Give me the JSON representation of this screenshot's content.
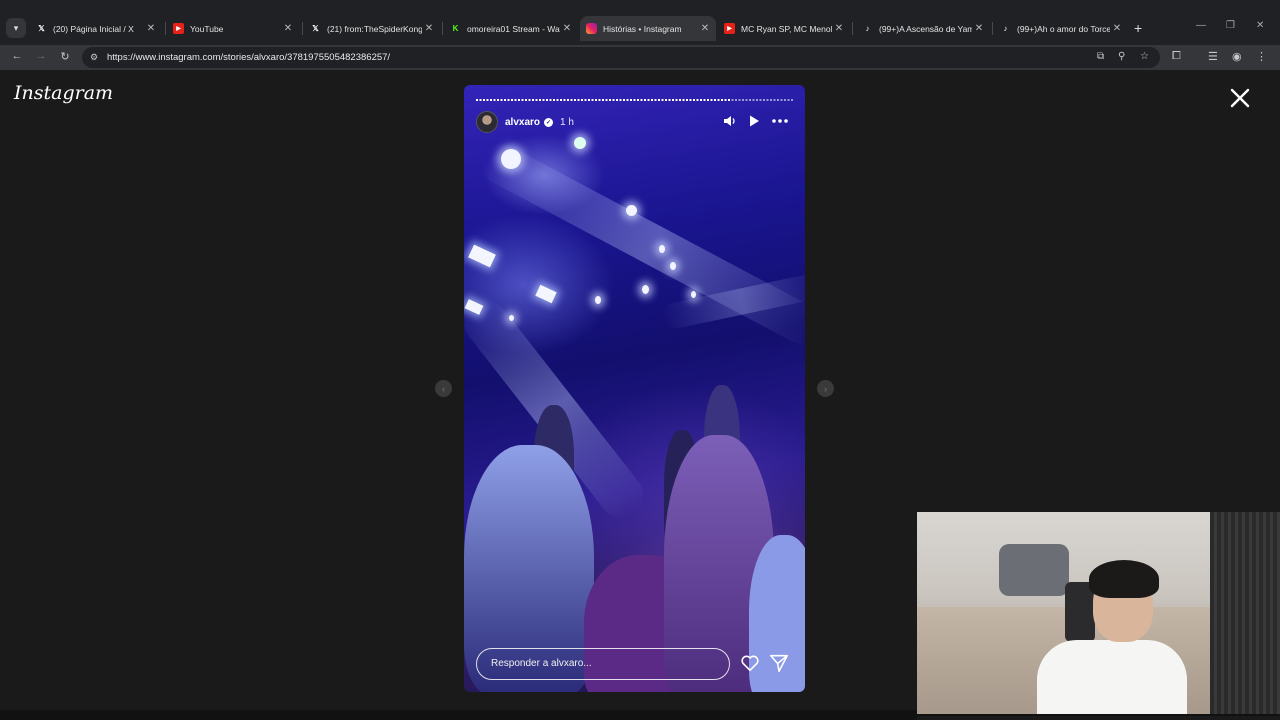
{
  "browser": {
    "tabs": [
      {
        "title": "(20) Página Inicial / X",
        "icon": "x-logo-icon",
        "active": false
      },
      {
        "title": "YouTube",
        "icon": "youtube-icon",
        "active": false
      },
      {
        "title": "(21) from:TheSpiderKong",
        "icon": "x-logo-icon",
        "active": false
      },
      {
        "title": "omoreira01 Stream - Wat",
        "icon": "kick-icon",
        "active": false
      },
      {
        "title": "Histórias • Instagram",
        "icon": "instagram-icon",
        "active": true
      },
      {
        "title": "MC Ryan SP, MC MenoK",
        "icon": "youtube-icon",
        "active": false
      },
      {
        "title": "(99+)A Ascensão de Yam",
        "icon": "tiktok-icon",
        "active": false
      },
      {
        "title": "(99+)Ah o amor do Torce",
        "icon": "tiktok-icon",
        "active": false
      }
    ],
    "url": "https://www.instagram.com/stories/alvxaro/3781975505482386257/"
  },
  "page": {
    "logo": "Instagram"
  },
  "story": {
    "username": "alvxaro",
    "time_ago": "1 h",
    "progress": 0.8,
    "reply_placeholder": "Responder a alvxaro...",
    "colors": {
      "accent": "#2a1fa8"
    }
  }
}
